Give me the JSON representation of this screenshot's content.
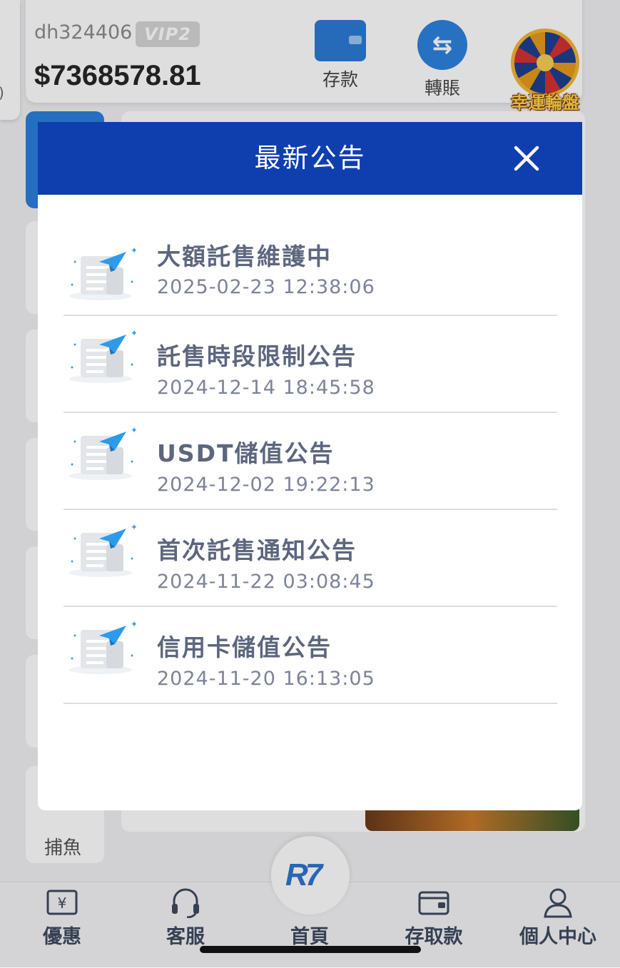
{
  "account": {
    "username": "dh324406",
    "vip": "VIP2",
    "balance": "$7368578.81"
  },
  "quick_actions": [
    {
      "label": "存款",
      "icon": "wallet-icon"
    },
    {
      "label": "轉賬",
      "icon": "transfer-icon"
    }
  ],
  "lucky_wheel": {
    "label": "幸運輪盤",
    "icon": "wheel-icon"
  },
  "side_category": {
    "label": "捕魚"
  },
  "modal": {
    "title": "最新公告",
    "close_icon": "close-icon",
    "header_color": "#0f3eaf",
    "notices": [
      {
        "title": "大額託售維護中",
        "time": "2025-02-23 12:38:06"
      },
      {
        "title": "託售時段限制公告",
        "time": "2024-12-14 18:45:58"
      },
      {
        "title": "USDT儲值公告",
        "time": "2024-12-02 19:22:13"
      },
      {
        "title": "首次託售通知公告",
        "time": "2024-11-22 03:08:45"
      },
      {
        "title": "信用卡儲值公告",
        "time": "2024-11-20 16:13:05"
      }
    ]
  },
  "bottom_nav": [
    {
      "label": "優惠",
      "icon": "coupon-icon"
    },
    {
      "label": "客服",
      "icon": "headset-icon"
    },
    {
      "label": "首頁",
      "icon": "home-logo-icon"
    },
    {
      "label": "存取款",
      "icon": "wallet-icon"
    },
    {
      "label": "個人中心",
      "icon": "user-icon"
    }
  ]
}
